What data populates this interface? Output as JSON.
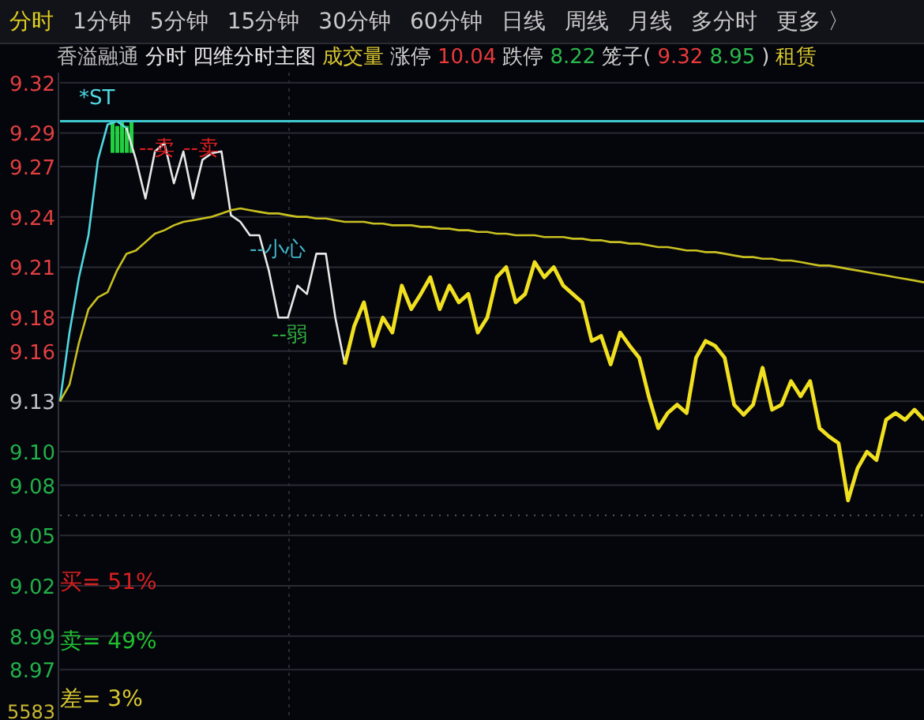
{
  "tabs": [
    {
      "label": "分时",
      "selected": true
    },
    {
      "label": "1分钟",
      "selected": false
    },
    {
      "label": "5分钟",
      "selected": false
    },
    {
      "label": "15分钟",
      "selected": false
    },
    {
      "label": "30分钟",
      "selected": false
    },
    {
      "label": "60分钟",
      "selected": false
    },
    {
      "label": "日线",
      "selected": false
    },
    {
      "label": "周线",
      "selected": false
    },
    {
      "label": "月线",
      "selected": false
    },
    {
      "label": "多分时",
      "selected": false
    },
    {
      "label": "更多 〉",
      "selected": false
    }
  ],
  "info_bar": [
    {
      "text": "香溢融通",
      "color": "#b8b8b8"
    },
    {
      "text": "分时",
      "color": "#e8e8e8"
    },
    {
      "text": "四维分时主图",
      "color": "#e8e8e8"
    },
    {
      "text": "成交量",
      "color": "#d8c830"
    },
    {
      "text": "涨停",
      "color": "#d0d0d0"
    },
    {
      "text": "10.04",
      "color": "#e83a3a"
    },
    {
      "text": "跌停",
      "color": "#d0d0d0"
    },
    {
      "text": "8.22",
      "color": "#2ab84a"
    },
    {
      "text": "笼子(",
      "color": "#d0d0d0"
    },
    {
      "text": "9.32",
      "color": "#e83a3a"
    },
    {
      "text": "8.95",
      "color": "#2ab84a"
    },
    {
      "text": ")",
      "color": "#d0d0d0"
    },
    {
      "text": "租赁",
      "color": "#d8c830"
    }
  ],
  "chart": {
    "chart_data": {
      "type": "line",
      "categories": [
        null,
        null,
        null,
        null,
        null,
        null,
        null,
        null,
        null,
        null,
        null,
        null,
        null,
        null,
        null,
        null,
        null,
        null,
        null,
        null,
        null,
        null,
        null,
        null,
        null,
        null,
        null,
        null,
        null,
        null,
        null,
        null,
        null,
        null,
        null,
        null,
        null,
        null,
        null,
        null,
        null,
        null,
        null,
        null,
        null,
        null,
        null,
        null,
        null,
        null,
        null,
        null,
        null,
        null,
        null,
        null,
        null,
        null,
        null,
        null,
        null,
        null,
        null,
        null,
        null,
        null,
        null,
        null,
        null,
        null,
        null,
        null,
        null,
        null,
        null,
        null,
        null,
        null,
        null,
        null,
        null,
        null,
        null,
        null,
        null,
        null,
        null,
        null,
        null,
        null,
        null,
        null
      ],
      "series": [
        {
          "color": "#50d8e0",
          "values": [
            9.13,
            9.171,
            9.204,
            9.229,
            9.274,
            9.295,
            9.297,
            9.293,
            null,
            null,
            null,
            null,
            null,
            null,
            null,
            null,
            null,
            null,
            null,
            null,
            null,
            null,
            null,
            null,
            null,
            null,
            null,
            null,
            null,
            null,
            null,
            null,
            null,
            null,
            null,
            null,
            null,
            null,
            null,
            null,
            null,
            null,
            null,
            null,
            null,
            null,
            null,
            null,
            null,
            null,
            null,
            null,
            null,
            null,
            null,
            null,
            null,
            null,
            null,
            null,
            null,
            null,
            null,
            null,
            null,
            null,
            null,
            null,
            null,
            null,
            null,
            null,
            null,
            null,
            null,
            null,
            null,
            null,
            null,
            null,
            null,
            null,
            null,
            null,
            null,
            null,
            null,
            null,
            null,
            null,
            null,
            null
          ]
        },
        {
          "color": "#e8e8e8",
          "values": [
            null,
            null,
            null,
            null,
            null,
            null,
            null,
            9.293,
            9.274,
            9.251,
            9.279,
            9.284,
            9.26,
            9.279,
            9.251,
            9.274,
            9.278,
            9.279,
            9.241,
            9.237,
            9.229,
            9.229,
            9.208,
            9.18,
            9.18,
            9.199,
            9.194,
            9.218,
            9.218,
            9.18,
            9.152,
            null,
            null,
            null,
            null,
            null,
            null,
            null,
            null,
            null,
            null,
            null,
            null,
            null,
            null,
            null,
            null,
            null,
            null,
            null,
            null,
            null,
            null,
            null,
            null,
            null,
            null,
            null,
            null,
            null,
            null,
            null,
            null,
            null,
            null,
            null,
            null,
            null,
            null,
            null,
            null,
            null,
            null,
            null,
            null,
            null,
            null,
            null,
            null,
            null,
            null,
            null,
            null,
            null,
            null,
            null,
            null,
            null,
            null,
            null,
            null,
            null
          ]
        },
        {
          "color": "#f0e020",
          "values": [
            null,
            null,
            null,
            null,
            null,
            null,
            null,
            null,
            null,
            null,
            null,
            null,
            null,
            null,
            null,
            null,
            null,
            null,
            null,
            null,
            null,
            null,
            null,
            null,
            null,
            null,
            null,
            null,
            null,
            null,
            9.152,
            9.175,
            9.189,
            9.163,
            9.18,
            9.171,
            9.199,
            9.185,
            9.194,
            9.204,
            9.185,
            9.199,
            9.189,
            9.194,
            9.171,
            9.18,
            9.204,
            9.21,
            9.189,
            9.194,
            9.213,
            9.204,
            9.21,
            9.199,
            9.194,
            9.189,
            9.166,
            9.169,
            9.152,
            9.171,
            9.163,
            9.156,
            9.133,
            9.114,
            9.123,
            9.128,
            9.123,
            9.156,
            9.166,
            9.163,
            9.156,
            9.128,
            9.122,
            9.128,
            9.15,
            9.125,
            9.128,
            9.142,
            9.133,
            9.142,
            9.114,
            9.109,
            9.105,
            9.071,
            9.09,
            9.1,
            9.095,
            9.119,
            9.123,
            9.119,
            9.125,
            9.119
          ]
        },
        {
          "color": "#c8c020",
          "values": [
            9.13,
            9.14,
            9.165,
            9.185,
            9.192,
            9.195,
            9.208,
            9.218,
            9.22,
            9.225,
            9.23,
            9.232,
            9.235,
            9.237,
            9.238,
            9.239,
            9.24,
            9.242,
            9.244,
            9.245,
            9.244,
            9.243,
            9.242,
            9.242,
            9.241,
            9.24,
            9.24,
            9.239,
            9.239,
            9.238,
            9.237,
            9.237,
            9.237,
            9.236,
            9.236,
            9.235,
            9.235,
            9.235,
            9.234,
            9.234,
            9.233,
            9.233,
            9.232,
            9.232,
            9.231,
            9.231,
            9.23,
            9.23,
            9.229,
            9.229,
            9.229,
            9.228,
            9.228,
            9.228,
            9.227,
            9.227,
            9.226,
            9.226,
            9.225,
            9.225,
            9.224,
            9.224,
            9.223,
            9.222,
            9.222,
            9.221,
            9.22,
            9.22,
            9.219,
            9.219,
            9.218,
            9.217,
            9.216,
            9.216,
            9.215,
            9.215,
            9.214,
            9.214,
            9.213,
            9.212,
            9.211,
            9.211,
            9.21,
            9.209,
            9.208,
            9.207,
            9.206,
            9.205,
            9.204,
            9.203,
            9.202,
            9.201
          ]
        },
        {
          "color": "#40c8d0",
          "values": [
            9.297,
            9.297,
            9.297,
            9.297,
            9.297,
            9.297,
            9.297,
            9.297,
            9.297,
            9.297,
            9.297,
            9.297,
            9.297,
            9.297,
            9.297,
            9.297,
            9.297,
            9.297,
            9.297,
            9.297,
            9.297,
            9.297,
            9.297,
            9.297,
            9.297,
            9.297,
            9.297,
            9.297,
            9.297,
            9.297,
            9.297,
            9.297,
            9.297,
            9.297,
            9.297,
            9.297,
            9.297,
            9.297,
            9.297,
            9.297,
            9.297,
            9.297,
            9.297,
            9.297,
            9.297,
            9.297,
            9.297,
            9.297,
            9.297,
            9.297,
            9.297,
            9.297,
            9.297,
            9.297,
            9.297,
            9.297,
            9.297,
            9.297,
            9.297,
            9.297,
            9.297,
            9.297,
            9.297,
            9.297,
            9.297,
            9.297,
            9.297,
            9.297,
            9.297,
            9.297,
            9.297,
            9.297,
            9.297,
            9.297,
            9.297,
            9.297,
            9.297,
            9.297,
            9.297,
            9.297,
            9.297,
            9.297,
            9.297,
            9.297,
            9.297,
            9.297,
            9.297,
            9.297,
            9.297,
            9.297,
            9.297,
            9.297
          ]
        },
        {
          "color": "#555560",
          "line_style": "dotted",
          "values": [
            9.062,
            9.062,
            9.062,
            9.062,
            9.062,
            9.062,
            9.062,
            9.062,
            9.062,
            9.062,
            9.062,
            9.062,
            9.062,
            9.062,
            9.062,
            9.062,
            9.062,
            9.062,
            9.062,
            9.062,
            9.062,
            9.062,
            9.062,
            9.062,
            9.062,
            9.062,
            9.062,
            9.062,
            9.062,
            9.062,
            9.062,
            9.062,
            9.062,
            9.062,
            9.062,
            9.062,
            9.062,
            9.062,
            9.062,
            9.062,
            9.062,
            9.062,
            9.062,
            9.062,
            9.062,
            9.062,
            9.062,
            9.062,
            9.062,
            9.062,
            9.062,
            9.062,
            9.062,
            9.062,
            9.062,
            9.062,
            9.062,
            9.062,
            9.062,
            9.062,
            9.062,
            9.062,
            9.062,
            9.062,
            9.062,
            9.062,
            9.062,
            9.062,
            9.062,
            9.062,
            9.062,
            9.062,
            9.062,
            9.062,
            9.062,
            9.062,
            9.062,
            9.062,
            9.062,
            9.062,
            9.062,
            9.062,
            9.062,
            9.062,
            9.062,
            9.062,
            9.062,
            9.062,
            9.062,
            9.062,
            9.062,
            9.062
          ]
        }
      ],
      "ylim": [
        8.94,
        9.326
      ],
      "yticks": [
        {
          "value": 9.32,
          "label": "9.32"
        },
        {
          "value": 9.29,
          "label": "9.29"
        },
        {
          "value": 9.27,
          "label": "9.27"
        },
        {
          "value": 9.24,
          "label": "9.24"
        },
        {
          "value": 9.21,
          "label": "9.21"
        },
        {
          "value": 9.18,
          "label": "9.18"
        },
        {
          "value": 9.16,
          "label": "9.16"
        },
        {
          "value": 9.13,
          "label": "9.13"
        },
        {
          "value": 9.1,
          "label": "9.10"
        },
        {
          "value": 9.08,
          "label": "9.08"
        },
        {
          "value": 9.05,
          "label": "9.05"
        },
        {
          "value": 9.02,
          "label": "9.02"
        },
        {
          "value": 8.99,
          "label": "8.99"
        },
        {
          "value": 8.97,
          "label": "8.97"
        }
      ],
      "grid": true
    },
    "signals": [
      {
        "text": "*ST",
        "color": "#50d8e0"
      },
      {
        "text": "--卖",
        "color": "#e02020"
      },
      {
        "text": "--卖",
        "color": "#e02020"
      },
      {
        "text": "--小心",
        "color": "#40b8c8"
      },
      {
        "text": "--弱",
        "color": "#30b040"
      }
    ],
    "ratios": [
      {
        "text": "买= 51%",
        "color": "#d82020"
      },
      {
        "text": "卖= 49%",
        "color": "#20c030"
      },
      {
        "text": "差= 3%",
        "color": "#d8c830"
      }
    ],
    "volume_label": "5583"
  }
}
